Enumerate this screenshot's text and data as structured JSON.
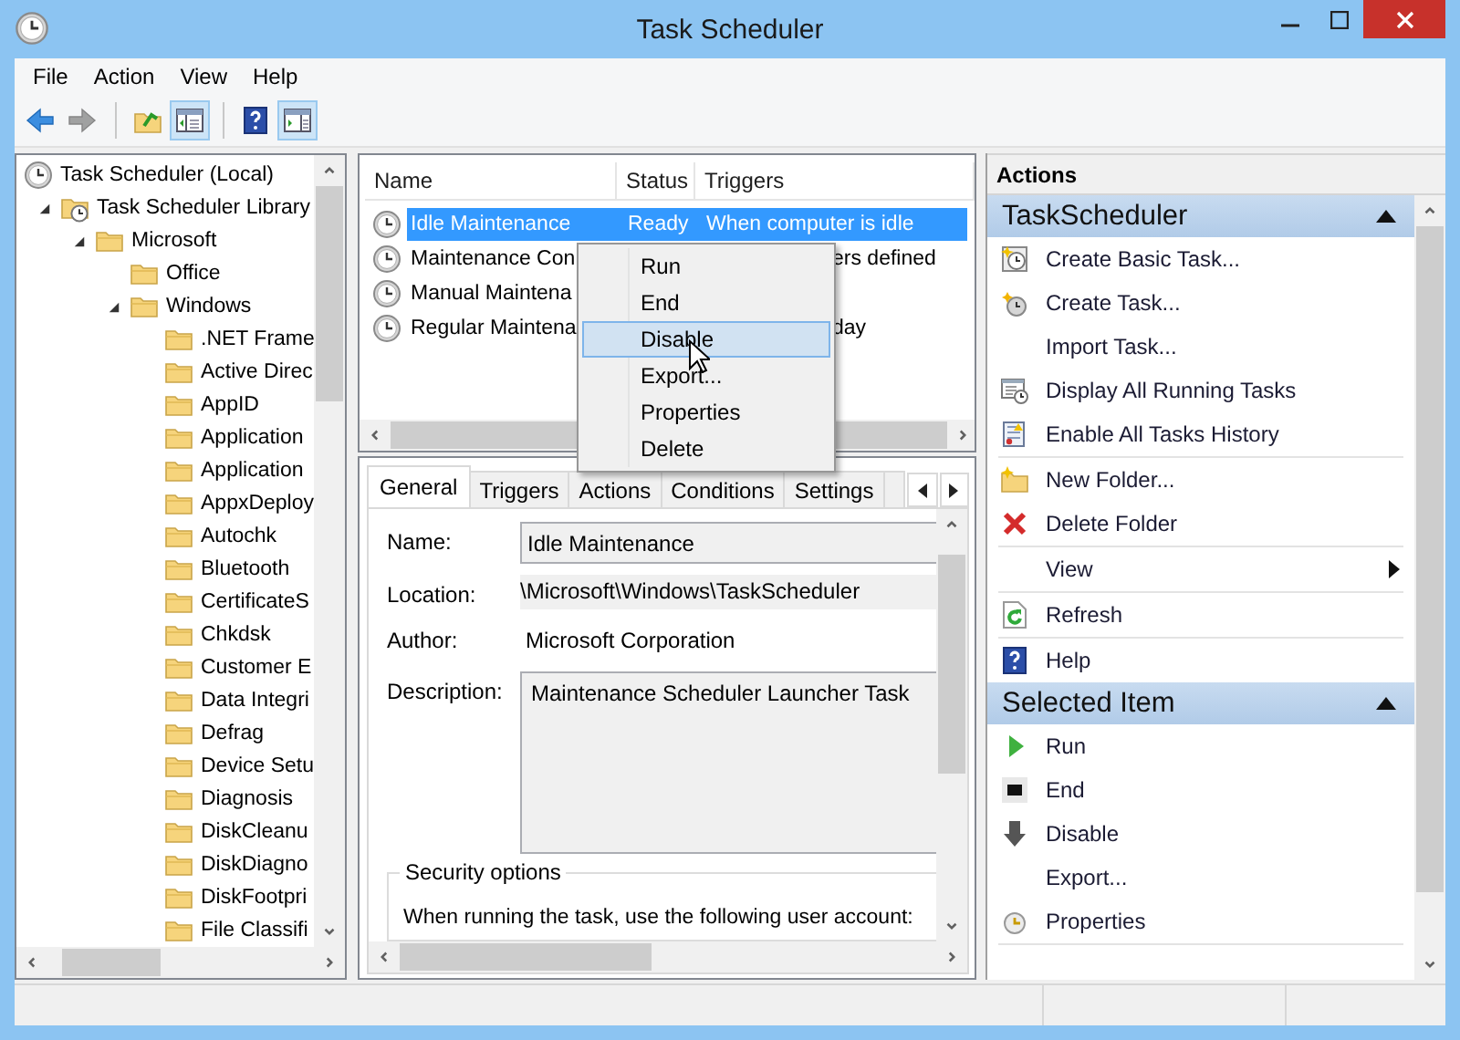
{
  "window": {
    "title": "Task Scheduler"
  },
  "menu": [
    "File",
    "Action",
    "View",
    "Help"
  ],
  "toolbar": [
    [
      {
        "pressed": false,
        "disabled": false
      },
      {
        "pressed": false,
        "disabled": true
      }
    ],
    [
      {
        "pressed": false,
        "disabled": false
      },
      {
        "pressed": true,
        "disabled": false
      }
    ],
    [
      {
        "pressed": false,
        "disabled": false
      },
      {
        "pressed": true,
        "disabled": false
      }
    ]
  ],
  "tree": {
    "root": {
      "label": "Task Scheduler (Local)",
      "children": [
        {
          "label": "Task Scheduler Library",
          "kind": "library",
          "expanded": true,
          "children": [
            {
              "label": "Microsoft",
              "kind": "folder",
              "expanded": true,
              "children": [
                {
                  "label": "Office",
                  "kind": "folder",
                  "expanded": false
                },
                {
                  "label": "Windows",
                  "kind": "folder",
                  "expanded": true,
                  "children": [
                    {
                      "label": ".NET Frame",
                      "kind": "folder",
                      "expanded": false
                    },
                    {
                      "label": "Active Direc",
                      "kind": "folder",
                      "expanded": false
                    },
                    {
                      "label": "AppID",
                      "kind": "folder",
                      "expanded": false
                    },
                    {
                      "label": "Application",
                      "kind": "folder",
                      "expanded": false
                    },
                    {
                      "label": "Application",
                      "kind": "folder",
                      "expanded": false
                    },
                    {
                      "label": "AppxDeploy",
                      "kind": "folder",
                      "expanded": false
                    },
                    {
                      "label": "Autochk",
                      "kind": "folder",
                      "expanded": false
                    },
                    {
                      "label": "Bluetooth",
                      "kind": "folder",
                      "expanded": false
                    },
                    {
                      "label": "CertificateS",
                      "kind": "folder",
                      "expanded": false
                    },
                    {
                      "label": "Chkdsk",
                      "kind": "folder",
                      "expanded": false
                    },
                    {
                      "label": "Customer E",
                      "kind": "folder",
                      "expanded": false
                    },
                    {
                      "label": "Data Integri",
                      "kind": "folder",
                      "expanded": false
                    },
                    {
                      "label": "Defrag",
                      "kind": "folder",
                      "expanded": false
                    },
                    {
                      "label": "Device Setu",
                      "kind": "folder",
                      "expanded": false
                    },
                    {
                      "label": "Diagnosis",
                      "kind": "folder",
                      "expanded": false
                    },
                    {
                      "label": "DiskCleanu",
                      "kind": "folder",
                      "expanded": false
                    },
                    {
                      "label": "DiskDiagno",
                      "kind": "folder",
                      "expanded": false
                    },
                    {
                      "label": "DiskFootpri",
                      "kind": "folder",
                      "expanded": false
                    },
                    {
                      "label": "File Classifi",
                      "kind": "folder",
                      "expanded": false
                    }
                  ]
                }
              ]
            }
          ]
        }
      ]
    }
  },
  "tasks": {
    "columns": [
      "Name",
      "Status",
      "Triggers"
    ],
    "rows": [
      {
        "name": "Idle Maintenance",
        "status": "Ready",
        "triggers": "When computer is idle",
        "selected": true
      },
      {
        "name": "Maintenance Con",
        "triggers": "ers defined",
        "selected": false
      },
      {
        "name": "Manual Maintena",
        "selected": false
      },
      {
        "name": "Regular Maintena",
        "triggers": "day",
        "selected": false
      }
    ]
  },
  "context_menu": {
    "items": [
      {
        "label": "Run",
        "selected": false
      },
      {
        "label": "End",
        "selected": false
      },
      {
        "label": "Disable",
        "selected": true
      },
      {
        "label": "Export...",
        "selected": false
      },
      {
        "label": "Properties",
        "selected": false
      },
      {
        "label": "Delete",
        "selected": false
      }
    ]
  },
  "details": {
    "tabs": [
      {
        "label": "General",
        "selected": true
      },
      {
        "label": "Triggers",
        "selected": false
      },
      {
        "label": "Actions",
        "selected": false
      },
      {
        "label": "Conditions",
        "selected": false
      },
      {
        "label": "Settings",
        "selected": false
      }
    ],
    "fields": [
      {
        "label": "Name:",
        "value": "Idle Maintenance",
        "kind": "input"
      },
      {
        "label": "Location:",
        "value": "\\Microsoft\\Windows\\TaskScheduler",
        "kind": "readonly"
      },
      {
        "label": "Author:",
        "value": "Microsoft Corporation",
        "kind": "text"
      },
      {
        "label": "Description:",
        "value": "Maintenance Scheduler Launcher Task",
        "kind": "textarea"
      }
    ],
    "security": {
      "title": "Security options",
      "text": "When running the task, use the following user account:"
    }
  },
  "actions": {
    "title": "Actions",
    "sections": [
      {
        "title": "TaskScheduler",
        "expanded": true,
        "groups": [
          [
            {
              "label": "Create Basic Task..."
            },
            {
              "label": "Create Task..."
            },
            {
              "label": "Import Task..."
            },
            {
              "label": "Display All Running Tasks"
            },
            {
              "label": "Enable All Tasks History"
            }
          ],
          [
            {
              "label": "New Folder..."
            },
            {
              "label": "Delete Folder"
            }
          ],
          [
            {
              "label": "View",
              "submenu": true
            }
          ],
          [
            {
              "label": "Refresh"
            }
          ],
          [
            {
              "label": "Help"
            }
          ]
        ]
      },
      {
        "title": "Selected Item",
        "expanded": true,
        "groups": [
          [
            {
              "label": "Run"
            },
            {
              "label": "End"
            },
            {
              "label": "Disable"
            },
            {
              "label": "Export..."
            },
            {
              "label": "Properties"
            }
          ]
        ]
      }
    ]
  }
}
